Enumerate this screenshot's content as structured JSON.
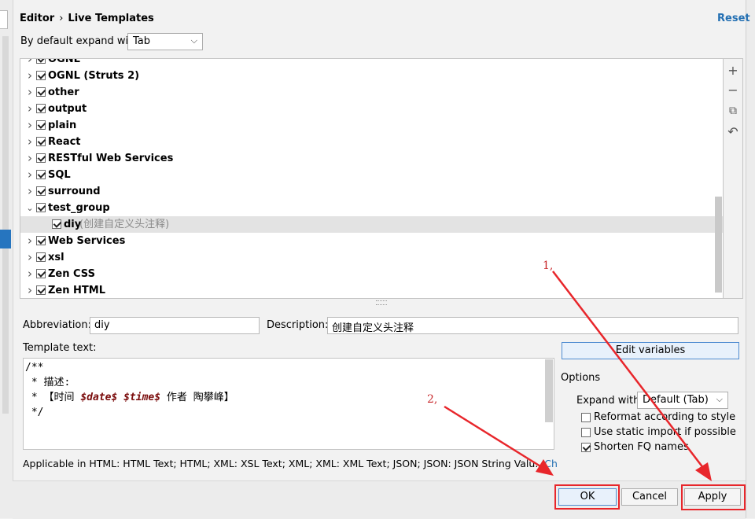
{
  "breadcrumb": {
    "parent": "Editor",
    "separator": "›",
    "current": "Live Templates"
  },
  "reset_label": "Reset",
  "expand_default": {
    "label": "By default expand with",
    "value": "Tab"
  },
  "tree": [
    {
      "label": "OGNL",
      "expanded": false,
      "checked": true,
      "partial": true
    },
    {
      "label": "OGNL (Struts 2)",
      "expanded": false,
      "checked": true
    },
    {
      "label": "other",
      "expanded": false,
      "checked": true
    },
    {
      "label": "output",
      "expanded": false,
      "checked": true
    },
    {
      "label": "plain",
      "expanded": false,
      "checked": true
    },
    {
      "label": "React",
      "expanded": false,
      "checked": true
    },
    {
      "label": "RESTful Web Services",
      "expanded": false,
      "checked": true
    },
    {
      "label": "SQL",
      "expanded": false,
      "checked": true
    },
    {
      "label": "surround",
      "expanded": false,
      "checked": true
    },
    {
      "label": "test_group",
      "expanded": true,
      "checked": true
    },
    {
      "label": "diy",
      "desc": "(创建自定义头注释)",
      "child": true,
      "checked": true,
      "selected": true
    },
    {
      "label": "Web Services",
      "expanded": false,
      "checked": true
    },
    {
      "label": "xsl",
      "expanded": false,
      "checked": true
    },
    {
      "label": "Zen CSS",
      "expanded": false,
      "checked": true
    },
    {
      "label": "Zen HTML",
      "expanded": false,
      "checked": true
    }
  ],
  "toolbar": {
    "add": "+",
    "remove": "−",
    "copy": "⧉",
    "restore": "↶"
  },
  "abbreviation": {
    "label": "Abbreviation:",
    "value": "diy"
  },
  "description": {
    "label": "Description:",
    "value": "创建自定义头注释"
  },
  "template_text": {
    "label": "Template text:",
    "lines": {
      "l1": "/**",
      "l2": " * 描述:",
      "l3_pre": " * 【时间 ",
      "l3_var1": "$date$",
      "l3_sp": " ",
      "l3_var2": "$time$",
      "l3_post": " 作者 陶攀峰】",
      "l4": " */"
    }
  },
  "edit_variables": "Edit variables",
  "options": {
    "title": "Options",
    "expand_with_label": "Expand with",
    "expand_with_value": "Default (Tab)",
    "reformat": {
      "label": "Reformat according to style",
      "checked": false
    },
    "static_import": {
      "label": "Use static import if possible",
      "checked": false
    },
    "shorten_fq": {
      "label": "Shorten FQ names",
      "checked": true
    }
  },
  "applicable": {
    "text": "Applicable in HTML: HTML Text; HTML; XML: XSL Text; XML; XML: XML Text; JSON; JSON: JSON String Valu...",
    "link": "Change"
  },
  "buttons": {
    "ok": "OK",
    "cancel": "Cancel",
    "apply": "Apply"
  },
  "annotations": {
    "a1": "1,",
    "a2": "2,"
  },
  "colors": {
    "annotation_red": "#e8262b",
    "link_blue": "#2470b3",
    "selection": "#2675bf"
  }
}
